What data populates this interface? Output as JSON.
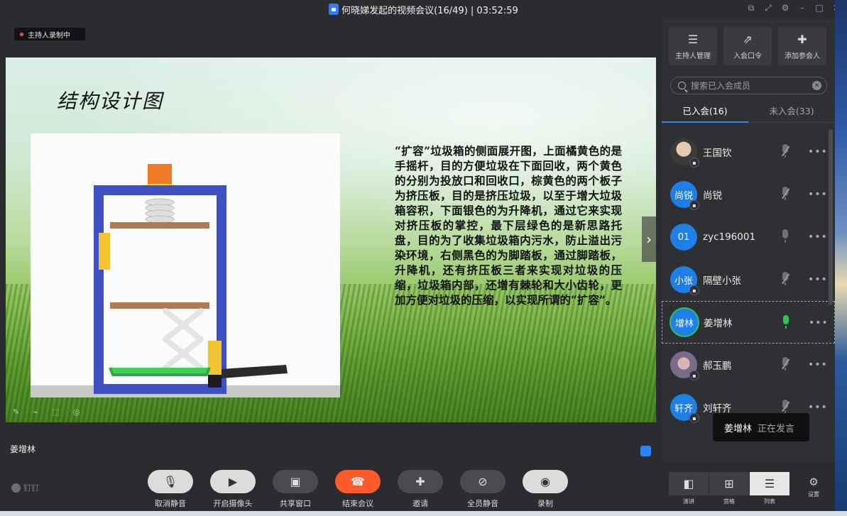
{
  "window": {
    "title": "何晓娣发起的视频会议(16/49) | 03:52:59",
    "controls": [
      "restore-icon",
      "fullscreen-icon",
      "settings-icon",
      "minimize-icon",
      "maximize-icon",
      "close-icon"
    ]
  },
  "stage": {
    "recording_badge": "主持人录制中",
    "speaker_name": "姜增林",
    "slide": {
      "title": "结构设计图",
      "body": "“扩容”垃圾箱的侧面展开图，上面橘黄色的是手摇杆，目的方便垃圾在下面回收，两个黄色的分别为投放口和回收口，棕黄色的两个板子为挤压板，目的是挤压垃圾，以至于增大垃圾箱容积，下面银色的为升降机，通过它来实现对挤压板的掌控，最下层绿色的是新思路托盘，目的为了收集垃圾箱内污水，防止溢出污染环境，右侧黑色的为脚踏板，通过脚踏板，升降机，还有挤压板三者来实现对垃圾的压缩，垃圾箱内部，还增有棘轮和大小齿轮，更加方便对垃圾的压缩，以实现所谓的“扩容”。"
    }
  },
  "panel": {
    "buttons": [
      {
        "label": "主持人管理",
        "icon": "sliders-icon"
      },
      {
        "label": "入会口令",
        "icon": "share-out-icon"
      },
      {
        "label": "添加参会人",
        "icon": "add-user-icon"
      }
    ],
    "search_placeholder": "搜索已入会成员",
    "tabs": [
      {
        "label": "已入会(16)",
        "active": true
      },
      {
        "label": "未入会(33)",
        "active": false
      }
    ],
    "members": [
      {
        "name": "王国钦",
        "avatar_text": "",
        "avatar": "photo",
        "mic": "muted"
      },
      {
        "name": "尚锐",
        "avatar_text": "尚锐",
        "avatar": "blue",
        "mic": "muted"
      },
      {
        "name": "zyc196001",
        "avatar_text": "01",
        "avatar": "blue",
        "mic": "off"
      },
      {
        "name": "隔壁小张",
        "avatar_text": "小张",
        "avatar": "blue",
        "mic": "muted"
      },
      {
        "name": "姜增林",
        "avatar_text": "增林",
        "avatar": "blue",
        "mic": "active"
      },
      {
        "name": "郝玉鹏",
        "avatar_text": "",
        "avatar": "photo",
        "mic": "muted"
      },
      {
        "name": "刘轩齐",
        "avatar_text": "轩齐",
        "avatar": "blue",
        "mic": "muted"
      }
    ],
    "speaking_tooltip": {
      "name": "姜增林",
      "status": "正在发言"
    }
  },
  "toolbar": {
    "logo": "钉钉",
    "buttons": [
      {
        "label": "取消静音",
        "icon": "mic-muted-icon",
        "style": "light"
      },
      {
        "label": "开启摄像头",
        "icon": "camera-off-icon",
        "style": "light"
      },
      {
        "label": "共享窗口",
        "icon": "share-window-icon",
        "style": "dark"
      },
      {
        "label": "结束会议",
        "icon": "hangup-icon",
        "style": "red"
      },
      {
        "label": "邀请",
        "icon": "invite-icon",
        "style": "dark"
      },
      {
        "label": "全员静音",
        "icon": "mute-all-icon",
        "style": "dark"
      },
      {
        "label": "录制",
        "icon": "record-icon",
        "style": "light"
      }
    ],
    "views": [
      {
        "label": "演讲",
        "icon": "speaker-view-icon",
        "active": false
      },
      {
        "label": "宫格",
        "icon": "grid-view-icon",
        "active": false
      },
      {
        "label": "列表",
        "icon": "list-view-icon",
        "active": true
      }
    ],
    "settings_label": "设置"
  },
  "colors": {
    "accent": "#2f86f7",
    "end_call": "#ff5a2a",
    "speaking": "#2fc15a",
    "frame_blue": "#3f4fc4"
  }
}
